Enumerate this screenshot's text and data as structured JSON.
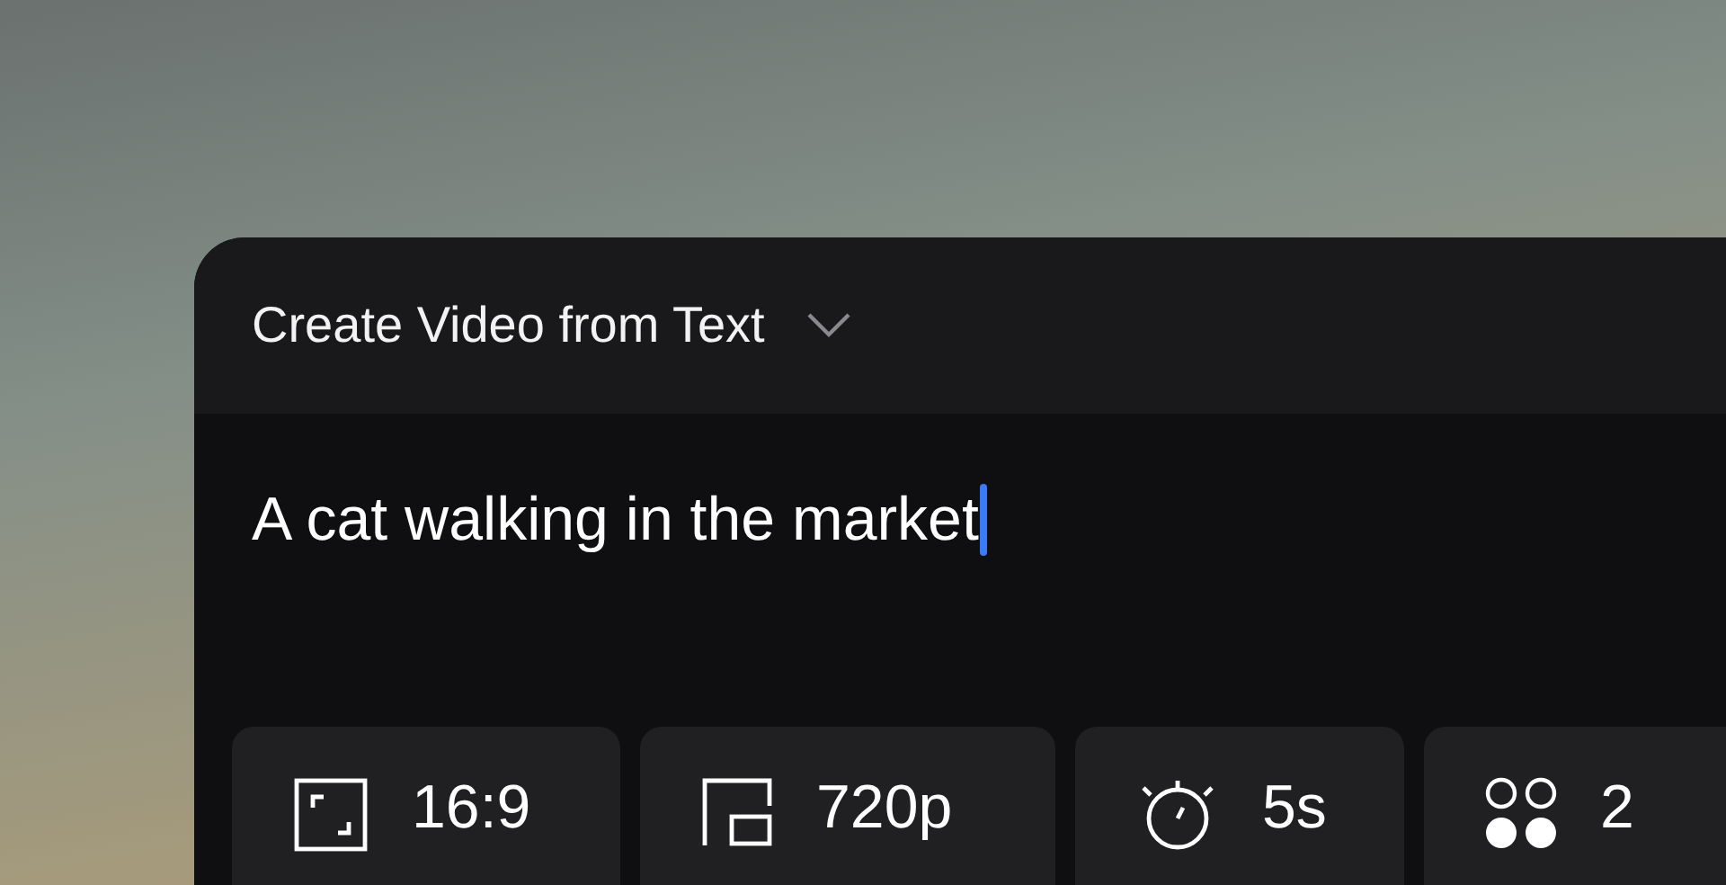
{
  "header": {
    "title": "Create Video from Text"
  },
  "prompt": {
    "value": "A cat walking in the market"
  },
  "options": [
    {
      "kind": "aspect",
      "label": "16:9"
    },
    {
      "kind": "resolution",
      "label": "720p"
    },
    {
      "kind": "duration",
      "label": "5s"
    },
    {
      "kind": "count",
      "label": "2"
    }
  ]
}
